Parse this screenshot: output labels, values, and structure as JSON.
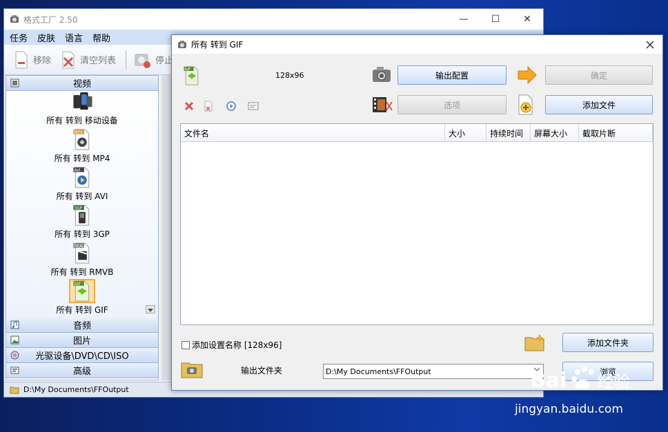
{
  "main_window": {
    "title": "格式工厂 2.50",
    "controls": {
      "minimize": "—",
      "maximize": "☐",
      "close": "✕"
    },
    "menu": [
      "任务",
      "皮肤",
      "语言",
      "帮助"
    ],
    "toolbar": {
      "remove": "移除",
      "clear_list": "清空列表",
      "stop": "停止"
    },
    "categories": {
      "video": "视频",
      "audio": "音频",
      "picture": "图片",
      "rom": "光驱设备\\DVD\\CD\\ISO",
      "advanced": "高级"
    },
    "video_items": [
      {
        "label": "所有 转到 移动设备",
        "badge": ""
      },
      {
        "label": "所有 转到 MP4",
        "badge": "MP4"
      },
      {
        "label": "所有 转到 AVI",
        "badge": "AVI"
      },
      {
        "label": "所有 转到 3GP",
        "badge": "3GP"
      },
      {
        "label": "所有 转到 RMVB",
        "badge": "REAL"
      },
      {
        "label": "所有 转到 GIF",
        "badge": "GIF"
      }
    ],
    "status_path": "D:\\My Documents\\FFOutput"
  },
  "dialog": {
    "title": "所有 转到 GIF",
    "format_badge": "GIF",
    "size": "128x96",
    "buttons": {
      "output_config": "输出配置",
      "ok": "确定",
      "options": "选项",
      "add_file": "添加文件",
      "add_folder": "添加文件夹",
      "browse": "浏览"
    },
    "table_columns": [
      "文件名",
      "大小",
      "持续时间",
      "屏幕大小",
      "截取片断"
    ],
    "add_setting_name": "添加设置名称 [128x96]",
    "output_folder_label": "输出文件夹",
    "output_path": "D:\\My Documents\\FFOutput"
  },
  "watermark": {
    "brand": "Bai",
    "brand2": "经验",
    "site": "jingyan.baidu.com"
  },
  "colors": {
    "accent": "#cfe0f7",
    "desktop": "#0a2d86",
    "selected": "#f2a93b"
  }
}
